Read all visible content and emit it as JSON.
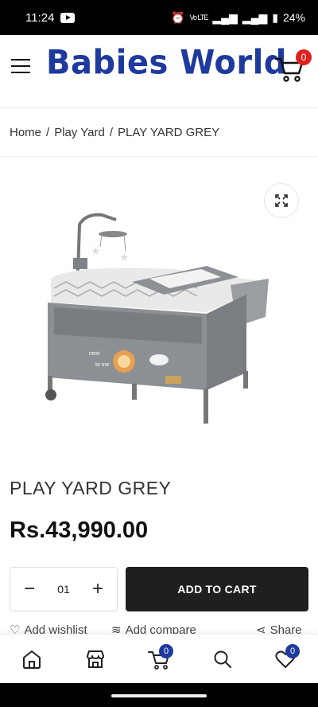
{
  "status": {
    "time": "11:24",
    "battery": "24%"
  },
  "header": {
    "logo": "Babies World",
    "cart_count": "0"
  },
  "breadcrumb": {
    "home": "Home",
    "sep": "/",
    "category": "Play Yard",
    "current": "PLAY YARD GREY"
  },
  "product": {
    "title": "PLAY YARD GREY",
    "price": "Rs.43,990.00",
    "quantity": "01",
    "add_to_cart": "ADD TO CART",
    "decal_text1": "next",
    "decal_text2": "to me"
  },
  "actions": {
    "wishlist": "Add wishlist",
    "compare": "Add compare",
    "share": "Share"
  },
  "bottom_nav": {
    "cart_count": "0",
    "wishlist_count": "0"
  },
  "colors": {
    "brand": "#1e3a9e",
    "badge_red": "#e02020",
    "button_dark": "#1f1f1f"
  }
}
